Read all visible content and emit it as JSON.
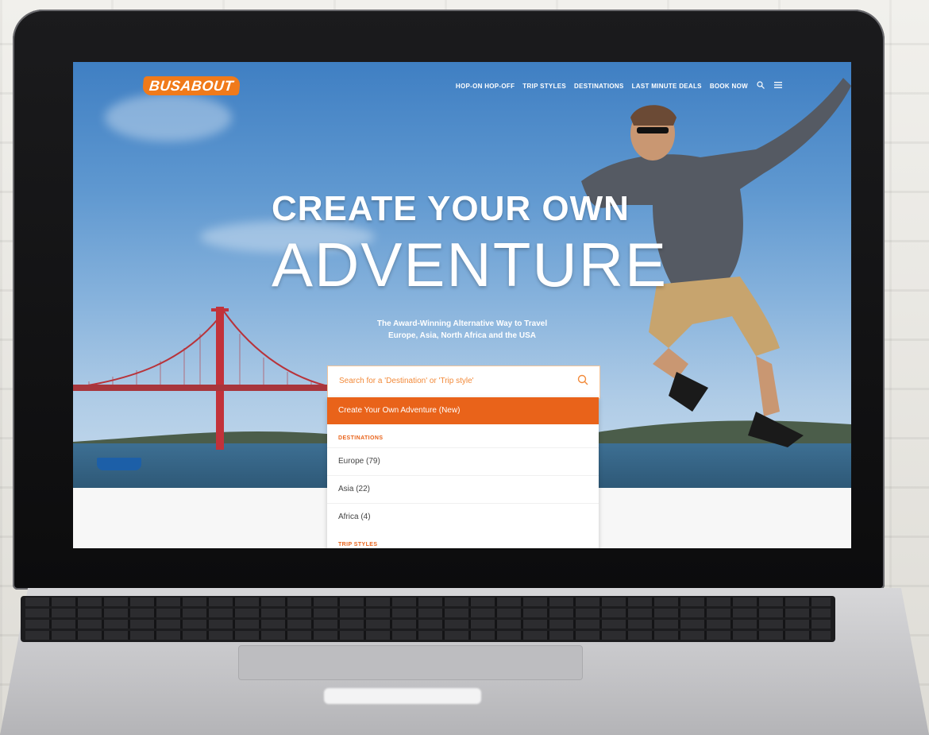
{
  "nav": {
    "logo": "BUSABOUT",
    "links": [
      "HOP-ON HOP-OFF",
      "TRIP STYLES",
      "DESTINATIONS",
      "LAST MINUTE DEALS",
      "BOOK NOW"
    ],
    "icons": [
      "search-icon",
      "menu-icon"
    ]
  },
  "hero": {
    "title_line1": "CREATE YOUR OWN",
    "title_line2": "ADVENTURE",
    "subtitle_line1": "The Award-Winning Alternative Way to Travel",
    "subtitle_line2": "Europe, Asia, North Africa and the USA"
  },
  "search": {
    "placeholder": "Search for a 'Destination' or 'Trip style'"
  },
  "dropdown": {
    "primary_option": "Create Your Own Adventure (New)",
    "heading_destinations": "DESTINATIONS",
    "items": [
      "Europe (79)",
      "Asia (22)",
      "Africa (4)"
    ],
    "heading_trip_styles": "TRIP STYLES"
  },
  "colors": {
    "brand_orange": "#e9631a",
    "sky_blue": "#5f98d0"
  }
}
